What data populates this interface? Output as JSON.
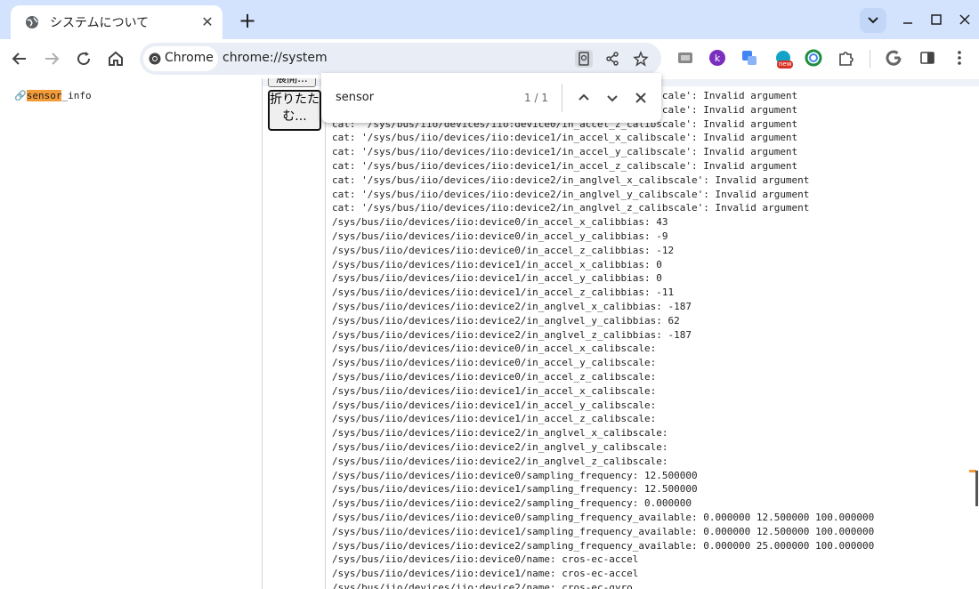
{
  "tab": {
    "title": "システムについて",
    "icon": "globe-icon"
  },
  "toolbar": {
    "chip_label": "Chrome",
    "url": "chrome://system"
  },
  "find": {
    "query": "sensor",
    "count": "1 / 1"
  },
  "sidebar": {
    "link_hl": "sensor",
    "link_rest": "_info"
  },
  "buttons": {
    "expand": "展開...",
    "collapse": "折りたたむ..."
  },
  "log_lines": [
    "cat: '/sys/bus/iio/devices/iio:device0/in_accel_x_calibscale': Invalid argument",
    "cat: '/sys/bus/iio/devices/iio:device0/in_accel_y_calibscale': Invalid argument",
    "cat: '/sys/bus/iio/devices/iio:device0/in_accel_z_calibscale': Invalid argument",
    "cat: '/sys/bus/iio/devices/iio:device1/in_accel_x_calibscale': Invalid argument",
    "cat: '/sys/bus/iio/devices/iio:device1/in_accel_y_calibscale': Invalid argument",
    "cat: '/sys/bus/iio/devices/iio:device1/in_accel_z_calibscale': Invalid argument",
    "cat: '/sys/bus/iio/devices/iio:device2/in_anglvel_x_calibscale': Invalid argument",
    "cat: '/sys/bus/iio/devices/iio:device2/in_anglvel_y_calibscale': Invalid argument",
    "cat: '/sys/bus/iio/devices/iio:device2/in_anglvel_z_calibscale': Invalid argument",
    "/sys/bus/iio/devices/iio:device0/in_accel_x_calibbias: 43",
    "/sys/bus/iio/devices/iio:device0/in_accel_y_calibbias: -9",
    "/sys/bus/iio/devices/iio:device0/in_accel_z_calibbias: -12",
    "/sys/bus/iio/devices/iio:device1/in_accel_x_calibbias: 0",
    "/sys/bus/iio/devices/iio:device1/in_accel_y_calibbias: 0",
    "/sys/bus/iio/devices/iio:device1/in_accel_z_calibbias: -11",
    "/sys/bus/iio/devices/iio:device2/in_anglvel_x_calibbias: -187",
    "/sys/bus/iio/devices/iio:device2/in_anglvel_y_calibbias: 62",
    "/sys/bus/iio/devices/iio:device2/in_anglvel_z_calibbias: -187",
    "/sys/bus/iio/devices/iio:device0/in_accel_x_calibscale:",
    "/sys/bus/iio/devices/iio:device0/in_accel_y_calibscale:",
    "/sys/bus/iio/devices/iio:device0/in_accel_z_calibscale:",
    "/sys/bus/iio/devices/iio:device1/in_accel_x_calibscale:",
    "/sys/bus/iio/devices/iio:device1/in_accel_y_calibscale:",
    "/sys/bus/iio/devices/iio:device1/in_accel_z_calibscale:",
    "/sys/bus/iio/devices/iio:device2/in_anglvel_x_calibscale:",
    "/sys/bus/iio/devices/iio:device2/in_anglvel_y_calibscale:",
    "/sys/bus/iio/devices/iio:device2/in_anglvel_z_calibscale:",
    "/sys/bus/iio/devices/iio:device0/sampling_frequency: 12.500000",
    "/sys/bus/iio/devices/iio:device1/sampling_frequency: 12.500000",
    "/sys/bus/iio/devices/iio:device2/sampling_frequency: 0.000000",
    "/sys/bus/iio/devices/iio:device0/sampling_frequency_available: 0.000000 12.500000 100.000000",
    "/sys/bus/iio/devices/iio:device1/sampling_frequency_available: 0.000000 12.500000 100.000000",
    "/sys/bus/iio/devices/iio:device2/sampling_frequency_available: 0.000000 25.000000 100.000000",
    "/sys/bus/iio/devices/iio:device0/name: cros-ec-accel",
    "/sys/bus/iio/devices/iio:device1/name: cros-ec-accel",
    "/sys/bus/iio/devices/iio:device2/name: cros-ec-gyro"
  ],
  "colors": {
    "tabstrip": "#d3e3fd",
    "omnibox": "#e9eef6",
    "highlight": "#f29b39",
    "new_badge": "#d93025"
  },
  "extensions": {
    "new_badge": "new"
  }
}
